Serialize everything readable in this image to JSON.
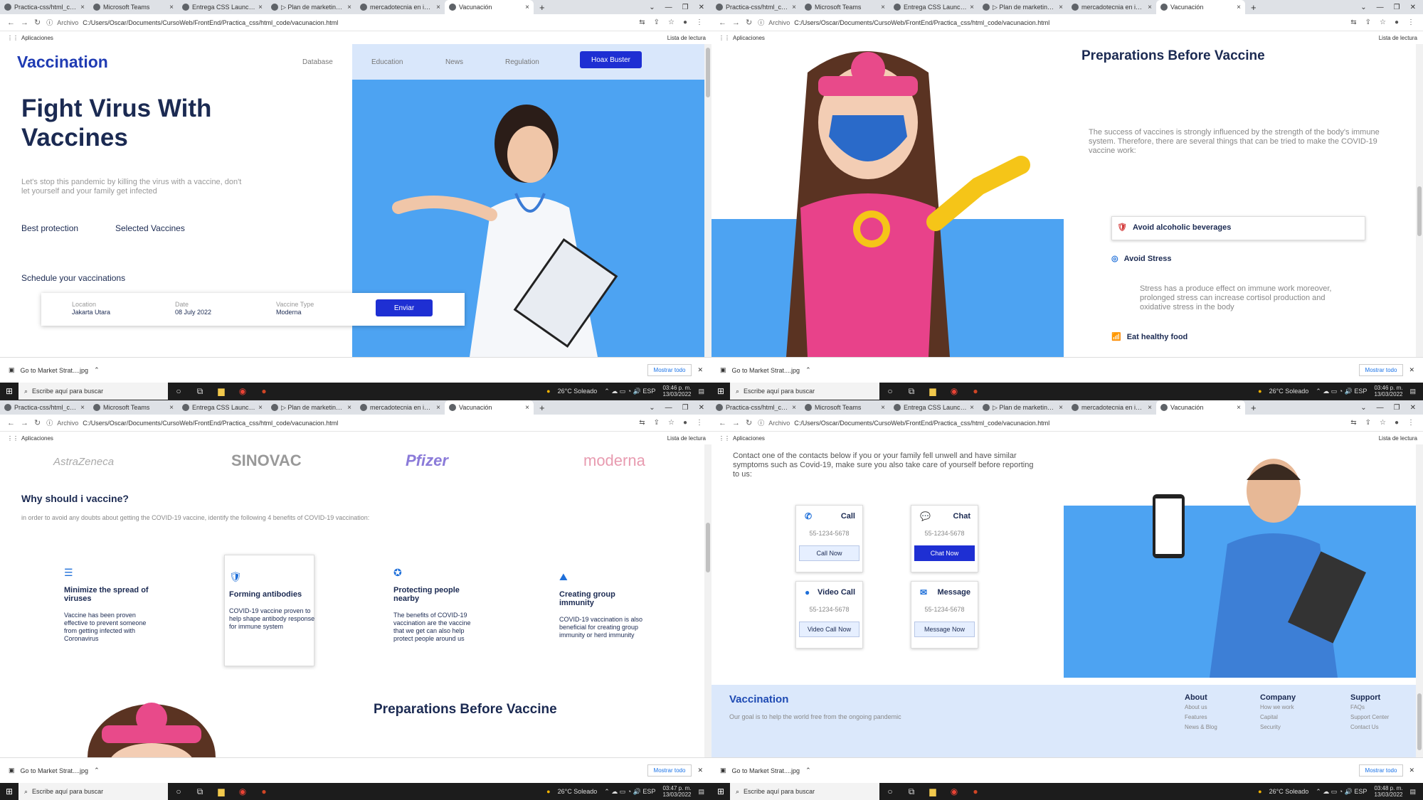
{
  "browser": {
    "tabs": [
      "Practica-css/html_code at ma...",
      "Microsoft Teams",
      "Entrega CSS LaunchX",
      "▷ Plan de marketing: qué es...",
      "mercadotecnia en ingles - B...",
      "Vacunación"
    ],
    "new_tab": "+",
    "archivo_label": "Archivo",
    "url": "C:/Users/Oscar/Documents/CursoWeb/FrontEnd/Practica_css/html_code/vacunacion.html",
    "bookmarks_label": "Aplicaciones",
    "reading_list": "Lista de lectura"
  },
  "downloads": {
    "file": "Go to Market Strat....jpg",
    "show_all": "Mostrar todo",
    "close": "✕"
  },
  "taskbar": {
    "search_placeholder": "Escribe aquí para buscar",
    "weather": "26°C  Soleado",
    "clocks": [
      {
        "time": "03:46 p. m.",
        "date": "13/03/2022"
      },
      {
        "time": "03:46 p. m.",
        "date": "13/03/2022"
      },
      {
        "time": "03:47 p. m.",
        "date": "13/03/2022"
      },
      {
        "time": "03:48 p. m.",
        "date": "13/03/2022"
      }
    ]
  },
  "site": {
    "logo": "Vaccination",
    "nav": [
      "Database",
      "Education",
      "News",
      "Regulation"
    ],
    "hoax_button": "Hoax Buster",
    "hero_title": "Fight Virus With Vaccines",
    "hero_desc": "Let's stop this pandemic by killing the virus with a vaccine, don't let yourself and your family get infected",
    "links": [
      "Best protection",
      "Selected Vaccines"
    ],
    "schedule_title": "Schedule your vaccinations",
    "form": {
      "location_label": "Location",
      "location_value": "Jakarta Utara",
      "date_label": "Date",
      "date_value": "08 July 2022",
      "type_label": "Vaccine Type",
      "type_value": "Moderna",
      "submit": "Enviar"
    },
    "prep_title": "Preparations Before Vaccine",
    "prep_desc": "The success of vaccines is strongly influenced by the strength of the body's immune system. Therefore, there are several things that can be tried to make the COVID-19 vaccine work:",
    "tips": [
      {
        "icon": "🛡",
        "title": "Avoid alcoholic beverages"
      },
      {
        "icon": "◎",
        "title": "Avoid Stress"
      },
      {
        "icon": "📶",
        "title": "Eat healthy food"
      }
    ],
    "stress_desc": "Stress has a produce effect on immune work moreover, prolonged stress can increase cortisol production and oxidative stress in the body",
    "brands": [
      "AstraZeneca",
      "SINOVAC",
      "Pfizer",
      "moderna"
    ],
    "why_title": "Why should i vaccine?",
    "why_desc": "in order to avoid any doubts about getting the COVID-19 vaccine, identify the following 4 benefits of COVID-19 vaccination:",
    "benefits": [
      {
        "icon": "☰",
        "title": "Minimize the spread of viruses",
        "desc": "Vaccine has been proven effective to prevent someone from getting infected with Coronavirus"
      },
      {
        "icon": "🛡",
        "title": "Forming antibodies",
        "desc": "COVID-19 vaccine proven to help shape antibody response for immune system"
      },
      {
        "icon": "✪",
        "title": "Protecting people nearby",
        "desc": "The benefits of COVID-19 vaccination are the vaccine that we get can also help protect people around us"
      },
      {
        "icon": "⛰",
        "title": "Creating group immunity",
        "desc": "COVID-19 vaccination is also beneficial for creating group immunity or herd immunity"
      }
    ],
    "contact_desc": "Contact one of the contacts below if you or your family fell unwell and have similar symptoms such as Covid-19, make sure you also take care of yourself before reporting to us:",
    "contacts": [
      {
        "icon": "✆",
        "title": "Call",
        "number": "55-1234-5678",
        "button": "Call Now"
      },
      {
        "icon": "💬",
        "title": "Chat",
        "number": "55-1234-5678",
        "button": "Chat Now"
      },
      {
        "icon": "●",
        "title": "Video Call",
        "number": "55-1234-5678",
        "button": "Video Call Now"
      },
      {
        "icon": "✉",
        "title": "Message",
        "number": "55-1234-5678",
        "button": "Message Now"
      }
    ],
    "footer": {
      "logo": "Vaccination",
      "tagline": "Our goal is to help the world free from the ongoing pandemic",
      "columns": [
        {
          "title": "About",
          "items": [
            "About us",
            "Features",
            "News & Blog"
          ]
        },
        {
          "title": "Company",
          "items": [
            "How we work",
            "Capital",
            "Security"
          ]
        },
        {
          "title": "Support",
          "items": [
            "FAQs",
            "Support Center",
            "Contact Us"
          ]
        }
      ]
    }
  },
  "colors": {
    "primary": "#1e2fd3",
    "sky": "#4da3f2",
    "navy": "#1b2a52",
    "light": "#d9e7fb"
  }
}
